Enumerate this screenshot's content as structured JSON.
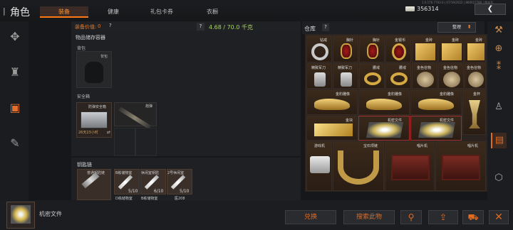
{
  "header": {
    "back_icon": "back-arrow-icon",
    "title": "角色",
    "tabs": [
      "装备",
      "健康",
      "礼包卡券",
      "衣橱"
    ],
    "active_tab": "装备",
    "build": "1.0.176.7703.0 | 07/19/2022 | 866027780 | 版本号",
    "money": "356314",
    "close_icon": "back-chevron-icon"
  },
  "sidebar": {
    "items": [
      "weapon-icon",
      "body-icon",
      "backpack-icon",
      "tools-icon"
    ],
    "active": "backpack-icon"
  },
  "equip": {
    "value_label": "装备价值:",
    "value": "0",
    "help": "?",
    "weight_help": "?",
    "weight": "4.68 / 70.0 千克"
  },
  "storage": {
    "title": "物品储存容器",
    "backpack_label": "背包",
    "backpack_name": "背包",
    "safebox_label": "安全箱",
    "safebox_name": "防弹安全箱",
    "safebox_timer": "26天23小时",
    "ammo_name": "炮弹"
  },
  "keychain": {
    "title": "钥匙链",
    "key1_name": "普通钥匙链",
    "keys": [
      {
        "name": "B栋储物室",
        "count": "5/10"
      },
      {
        "name": "休闲室钥匙",
        "count": "6/10"
      },
      {
        "name": "2号休闲室",
        "count": "5/10"
      }
    ],
    "keys_row2": [
      "D栋储物室",
      "B栋储物室",
      "医208"
    ]
  },
  "bottom": {
    "selected_item": "机密文件",
    "exchange": "兑换",
    "search_item": "搜索此物",
    "search_icon": "search-icon",
    "share_icon": "share-icon",
    "cart_icon": "cart-icon",
    "close_icon": "close-icon"
  },
  "warehouse": {
    "title": "仓库",
    "help": "?",
    "sort": "整理",
    "items": [
      {
        "name": "钻戒"
      },
      {
        "name": "胸针"
      },
      {
        "name": "胸针"
      },
      {
        "name": "金银币"
      },
      {
        "name": "金砖"
      },
      {
        "name": "金砖"
      },
      {
        "name": "金砖"
      },
      {
        "name": "精致军刀"
      },
      {
        "name": "精致军刀"
      },
      {
        "name": "腰戒"
      },
      {
        "name": "腰戒"
      },
      {
        "name": "金色信物"
      },
      {
        "name": "金色信物"
      },
      {
        "name": "金色信物"
      },
      {
        "name": "金豹雕像"
      },
      {
        "name": "金豹雕像"
      },
      {
        "name": "金豹雕像"
      },
      {
        "name": "金杯"
      },
      {
        "name": "金块"
      },
      {
        "name": "机密文件"
      },
      {
        "name": "机密文件"
      },
      {
        "name": "游戏机"
      },
      {
        "name": "宝石项链"
      },
      {
        "name": "唱片机"
      },
      {
        "name": "唱片机"
      }
    ]
  },
  "wh_side": {
    "items": [
      "rifle-icon",
      "grenade-icon",
      "bullet-icon",
      "armor-icon",
      "bag-icon",
      "box-icon",
      "cube-icon"
    ]
  },
  "colors": {
    "accent": "#e06a20",
    "weight": "#a8d55e",
    "gold": "#d4a843"
  }
}
